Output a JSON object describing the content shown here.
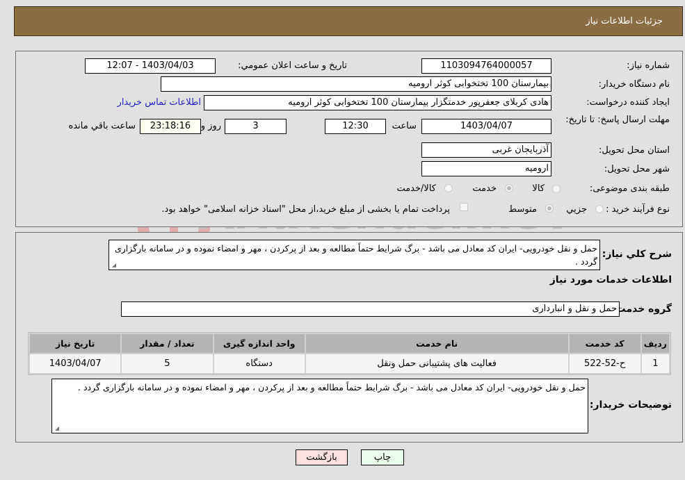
{
  "header": {
    "title": "جزئیات اطلاعات نیاز"
  },
  "details": {
    "need_number_label": "شماره نیاز:",
    "need_number": "1103094764000057",
    "announce_label": "تاریخ و ساعت اعلان عمومي:",
    "announce_value": "1403/04/03 - 12:07",
    "buyer_org_label": "نام دستگاه خریدار:",
    "buyer_org": "بیمارستان 100 تختخوابی کوثر ارومیه",
    "creator_label": "ایجاد کننده درخواست:",
    "creator": "هادی کربلای جعفرپور خدمتگزار بیمارستان 100 تختخوابی کوثر ارومیه",
    "contact_link": "اطلاعات تماس خریدار",
    "deadline_label": "مهلت ارسال پاسخ: تا تاریخ:",
    "deadline_date": "1403/04/07",
    "time_label": "ساعت",
    "deadline_time": "12:30",
    "days_value": "3",
    "days_label": "روز و",
    "remaining_time": "23:18:16",
    "remaining_label": "ساعت باقي مانده",
    "province_label": "استان محل تحویل:",
    "province": "آذربایجان غربی",
    "city_label": "شهر محل تحویل:",
    "city": "ارومیه",
    "category_label": "طبقه بندی موضوعی:",
    "category_options": [
      {
        "label": "کالا",
        "checked": false
      },
      {
        "label": "خدمت",
        "checked": true
      },
      {
        "label": "کالا/خدمت",
        "checked": false
      }
    ],
    "process_label": "نوع فرآیند خرید :",
    "process_options": [
      {
        "label": "جزيي",
        "checked": false
      },
      {
        "label": "متوسط",
        "checked": true
      }
    ],
    "treasury_note": "پرداخت تمام یا بخشی از مبلغ خرید،از محل \"اسناد خزانه اسلامی\" خواهد بود."
  },
  "summary": {
    "label": "شرح کلي نیاز:",
    "text": "حمل و نقل خودرویی- ایران کد معادل می باشد  - برگ شرایط حتماً مطالعه و بعد از پرکردن ، مهر و امضاء نموده و در سامانه بارگزاری گردد ."
  },
  "services": {
    "section_title": "اطلاعات خدمات مورد نیاز",
    "group_label": "گروه خدمت:",
    "group_value": "حمل و نقل و انبارداری",
    "columns": [
      "ردیف",
      "کد خدمت",
      "نام خدمت",
      "واحد اندازه گیری",
      "تعداد / مقدار",
      "تاریخ نیاز"
    ],
    "rows": [
      [
        "1",
        "ح-52-522",
        "فعالیت های پشتیبانی حمل ونقل",
        "دستگاه",
        "5",
        "1403/04/07"
      ]
    ]
  },
  "buyer_notes": {
    "label": "توضیحات خریدار:",
    "text": "حمل و نقل خودرویی- ایران کد معادل می باشد  - برگ شرایط حتماً مطالعه و بعد از پرکردن ، مهر و امضاء نموده و در سامانه بارگزاری گردد ."
  },
  "buttons": {
    "print": "چاپ",
    "back": "بازگشت"
  },
  "watermark": {
    "text": "AriaTender.neT"
  }
}
